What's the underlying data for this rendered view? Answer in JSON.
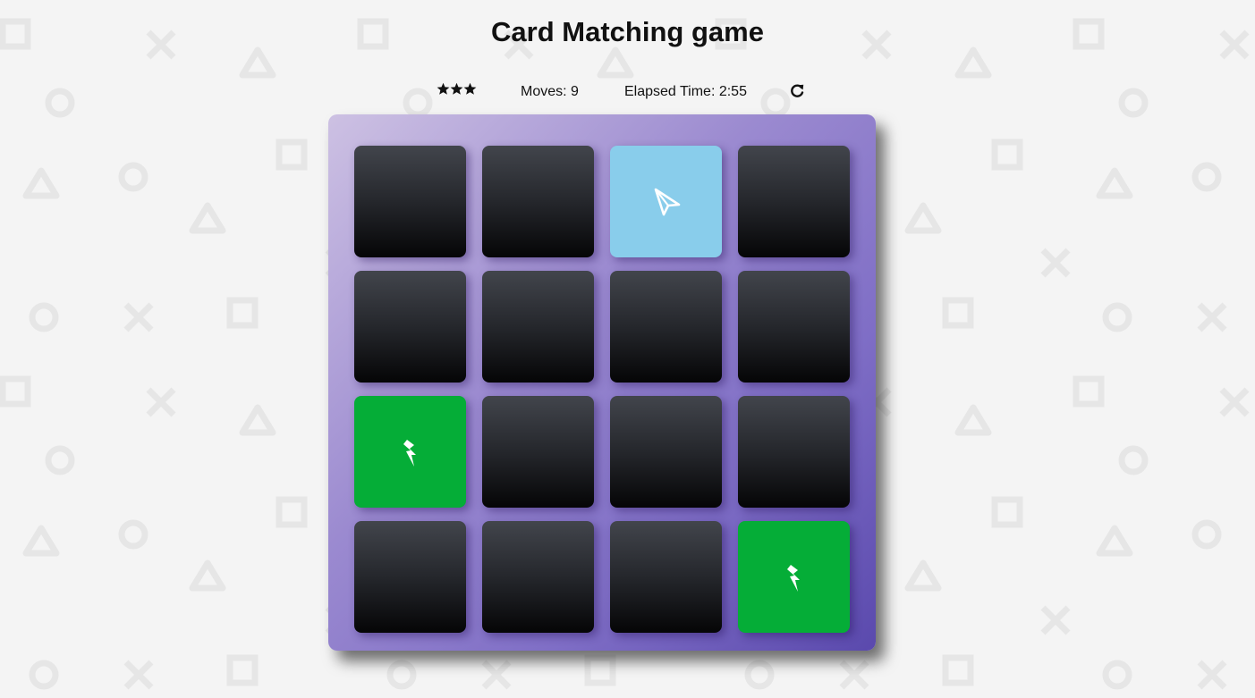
{
  "page": {
    "title": "Card Matching game"
  },
  "score_panel": {
    "stars_count": 3,
    "moves_text": "Moves: 9",
    "timer_text": "Elapsed Time: 2:55",
    "restart_icon": "redo-icon"
  },
  "deck": {
    "rows": 4,
    "cols": 4,
    "cards": [
      {
        "state": "closed",
        "icon": ""
      },
      {
        "state": "closed",
        "icon": ""
      },
      {
        "state": "open",
        "icon": "paper-plane-icon"
      },
      {
        "state": "closed",
        "icon": ""
      },
      {
        "state": "closed",
        "icon": ""
      },
      {
        "state": "closed",
        "icon": ""
      },
      {
        "state": "closed",
        "icon": ""
      },
      {
        "state": "closed",
        "icon": ""
      },
      {
        "state": "match",
        "icon": "bolt-icon"
      },
      {
        "state": "closed",
        "icon": ""
      },
      {
        "state": "closed",
        "icon": ""
      },
      {
        "state": "closed",
        "icon": ""
      },
      {
        "state": "closed",
        "icon": ""
      },
      {
        "state": "closed",
        "icon": ""
      },
      {
        "state": "closed",
        "icon": ""
      },
      {
        "state": "match",
        "icon": "bolt-icon"
      }
    ]
  },
  "colors": {
    "background": "#f4f4f4",
    "card_closed": "#25272c",
    "card_open": "#89cdeb",
    "card_match": "#05ad37",
    "deck_gradient_start": "#cdc1e3",
    "deck_gradient_end": "#5a49ad"
  }
}
